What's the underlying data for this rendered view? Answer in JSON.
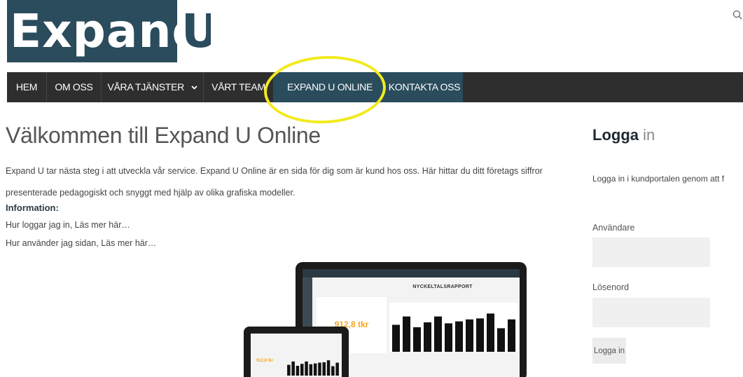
{
  "logo": {
    "part1": "Expand",
    "part2": "U"
  },
  "nav": {
    "items": [
      {
        "label": "HEM"
      },
      {
        "label": "OM OSS"
      },
      {
        "label": "VÅRA TJÄNSTER"
      },
      {
        "label": "VÅRT TEAM"
      },
      {
        "label": "EXPAND U ONLINE"
      },
      {
        "label": "KONTAKTA OSS"
      }
    ],
    "active": "EXPAND U ONLINE"
  },
  "main": {
    "title": "Välkommen till Expand U Online",
    "intro": "Expand U tar nästa steg i att utveckla vår service. Expand U Online är en sida för dig som är kund hos oss. Här hittar du ditt företags siffror presenterade pedagogiskt och snyggt med hjälp av olika grafiska modeller.",
    "info_heading": "Information:",
    "info_line1": "Hur loggar jag in, Läs mer här…",
    "info_line2": "Hur använder jag sidan, Läs mer här…"
  },
  "devices_image": {
    "report_title": "NYCKELTALSRAPPORT",
    "big_value": "912,8 tkr",
    "tablet_value": "912,8 tkr",
    "bars": [
      0.55,
      0.72,
      0.5,
      0.6,
      0.72,
      0.58,
      0.62,
      0.66,
      0.68,
      0.78,
      0.48,
      0.66
    ]
  },
  "login": {
    "title_bold": "Logga",
    "title_light": "in",
    "description": "Logga in i kundportalen genom att f",
    "username_label": "Användare",
    "password_label": "Lösenord",
    "button_label": "Logga in"
  },
  "colors": {
    "brand": "#2a4c5c",
    "navbar": "#2e2e2e",
    "highlight": "#f2ea1e",
    "accent_value": "#f5a623"
  }
}
